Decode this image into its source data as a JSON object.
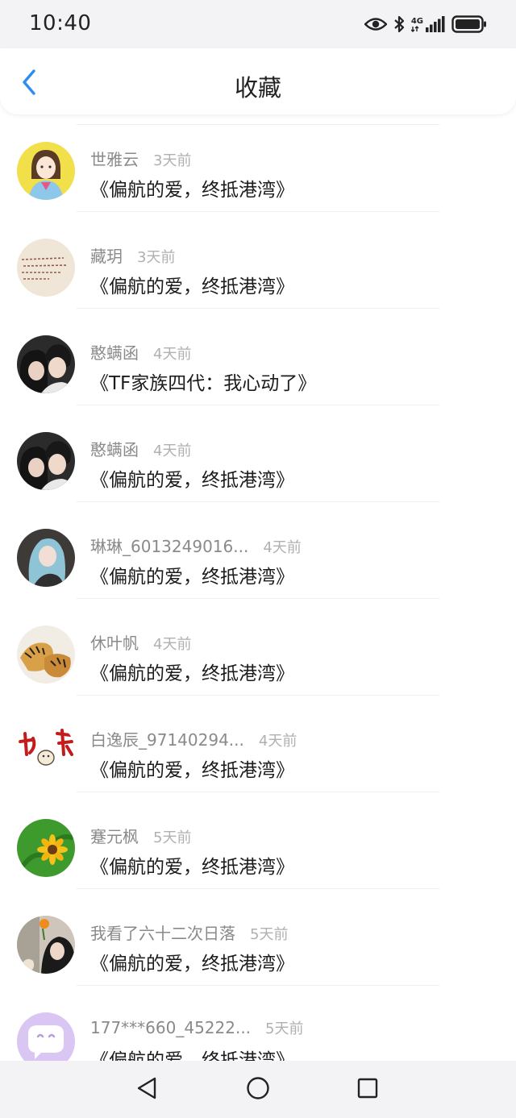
{
  "status_bar": {
    "time": "10:40",
    "network": "4G",
    "icons": [
      "eye-icon",
      "bluetooth-icon",
      "signal-icon",
      "battery-icon"
    ]
  },
  "header": {
    "title": "收藏",
    "back_icon": "chevron-left-icon"
  },
  "colors": {
    "accent": "#2b8ef0",
    "name": "#8a8a8a",
    "time": "#b0b0b0",
    "title": "#1c1c1c"
  },
  "items": [
    {
      "name": "世雅云",
      "time": "3天前",
      "title": "《偏航的爱，终抵港湾》",
      "avatar": "girl-illustration-avatar"
    },
    {
      "name": "藏玥",
      "time": "3天前",
      "title": "《偏航的爱，终抵港湾》",
      "avatar": "handwriting-avatar"
    },
    {
      "name": "憨螨函",
      "time": "4天前",
      "title": "《TF家族四代：我心动了》",
      "avatar": "couple-photo-avatar"
    },
    {
      "name": "憨螨函",
      "time": "4天前",
      "title": "《偏航的爱，终抵港湾》",
      "avatar": "couple-photo-avatar"
    },
    {
      "name": "琳琳_6013249016...",
      "time": "4天前",
      "title": "《偏航的爱，终抵港湾》",
      "avatar": "blue-hair-girl-avatar"
    },
    {
      "name": "休叶帆",
      "time": "4天前",
      "title": "《偏航的爱，终抵港湾》",
      "avatar": "tiger-avatar"
    },
    {
      "name": "白逸辰_97140294...",
      "time": "4天前",
      "title": "《偏航的爱，终抵港湾》",
      "avatar": "calligraphy-dog-avatar"
    },
    {
      "name": "蹇元枫",
      "time": "5天前",
      "title": "《偏航的爱，终抵港湾》",
      "avatar": "sunflower-avatar"
    },
    {
      "name": "我看了六十二次日落",
      "time": "5天前",
      "title": "《偏航的爱，终抵港湾》",
      "avatar": "girl-flower-avatar"
    },
    {
      "name": "177***660_45222...",
      "time": "5天前",
      "title": "《偏航的爱，终抵港湾》",
      "avatar": "default-chat-avatar"
    }
  ],
  "nav_bar": {
    "buttons": [
      "back-triangle-icon",
      "home-circle-icon",
      "recents-square-icon"
    ]
  }
}
